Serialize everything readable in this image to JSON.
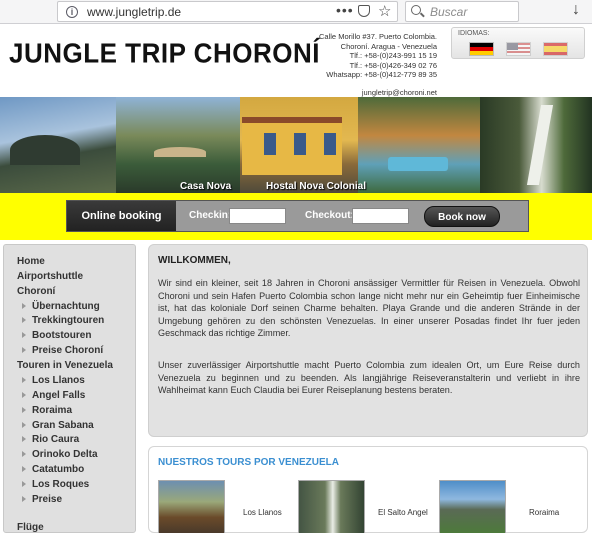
{
  "browser": {
    "url": "www.jungletrip.de",
    "more_glyph": "•••",
    "star_glyph": "☆",
    "search_placeholder": "Buscar",
    "download_glyph": "↓",
    "info_glyph": "i"
  },
  "header": {
    "logo": "JUNGLE TRIP CHORONÍ",
    "address_lines": [
      "Calle Morillo #37. Puerto Colombia.",
      "Choroní. Aragua - Venezuela",
      "Tlf.: +58-(0)243-991 15 19",
      "Tlf.: +58-(0)426-349 02 76",
      "Whatsapp: +58-(0)412-779 89 35"
    ],
    "email": "jungletrip@choroni.net",
    "languages_title": "IDIOMAS:"
  },
  "banner": {
    "captions": [
      "Casa Nova",
      "Hostal Nova Colonial"
    ]
  },
  "booking": {
    "title": "Online booking",
    "checkin_label": "Checkin:",
    "checkout_label": "Checkout:",
    "button": "Book now"
  },
  "sidebar": {
    "items": [
      {
        "label": "Home",
        "level": 0
      },
      {
        "label": "Airportshuttle",
        "level": 0
      },
      {
        "label": "Choroní",
        "level": 0
      },
      {
        "label": "Übernachtung",
        "level": 1
      },
      {
        "label": "Trekkingtouren",
        "level": 1
      },
      {
        "label": "Bootstouren",
        "level": 1
      },
      {
        "label": "Preise Choroní",
        "level": 1
      },
      {
        "label": "Touren in Venezuela",
        "level": 0
      },
      {
        "label": "Los Llanos",
        "level": 1
      },
      {
        "label": "Angel Falls",
        "level": 1
      },
      {
        "label": "Roraima",
        "level": 1
      },
      {
        "label": "Gran Sabana",
        "level": 1
      },
      {
        "label": "Rio Caura",
        "level": 1
      },
      {
        "label": "Orinoko Delta",
        "level": 1
      },
      {
        "label": "Catatumbo",
        "level": 1
      },
      {
        "label": "Los Roques",
        "level": 1
      },
      {
        "label": "Preise",
        "level": 1
      },
      {
        "label": "Flüge",
        "level": 0
      }
    ]
  },
  "welcome": {
    "title": "WILLKOMMEN,",
    "p1": "Wir sind ein kleiner, seit 18 Jahren in Choroni ansässiger Vermittler für Reisen in Venezuela. Obwohl Choroni und sein Hafen Puerto Colombia schon lange nicht mehr nur ein Geheimtip fuer Einheimische ist, hat das koloniale Dorf seinen Charme behalten. Playa Grande und die anderen Strände in der Umgebung gehören zu den schönsten Venezuelas. In einer unserer Posadas findet Ihr fuer jeden Geschmack das richtige Zimmer.",
    "p2": "Unser zuverlässiger Airportshuttle macht Puerto Colombia zum idealen Ort, um Eure Reise durch Venezuela zu beginnen und zu beenden. Als langjährige Reiseveranstalterin und verliebt in ihre Wahlheimat kann Euch Claudia bei Eurer Reiseplanung bestens beraten."
  },
  "tours": {
    "title": "NUESTROS TOURS POR VENEZUELA",
    "items": [
      {
        "label": "Los Llanos"
      },
      {
        "label": "El Salto Angel"
      },
      {
        "label": "Roraima"
      }
    ]
  }
}
